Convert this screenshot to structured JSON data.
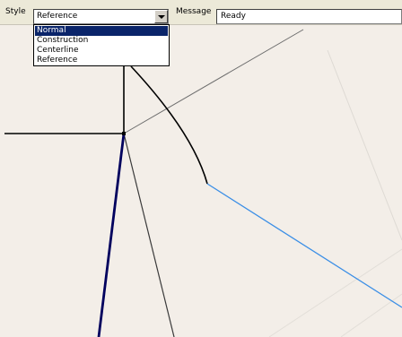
{
  "toolbar": {
    "style_label": "Style",
    "style_value": "Reference",
    "message_label": "Message",
    "message_value": "Ready"
  },
  "style_dropdown": {
    "expanded": true,
    "options": [
      "Normal",
      "Construction",
      "Centerline",
      "Reference"
    ],
    "highlighted": "Normal"
  },
  "drawing": {
    "line_colors": {
      "geometry": "#000000",
      "construction": "#5a5a5a",
      "selected": "#00005e",
      "highlight_blue": "#3a8ee6",
      "faint_reference": "#dedad4"
    }
  }
}
